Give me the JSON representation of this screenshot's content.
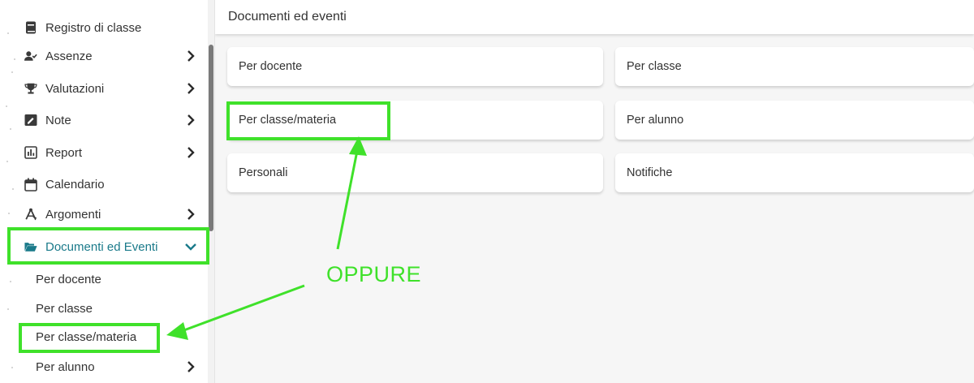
{
  "sidebar": {
    "items": [
      {
        "label": "Registro di classe",
        "icon": "book-icon"
      },
      {
        "label": "Assenze",
        "icon": "user-check-icon"
      },
      {
        "label": "Valutazioni",
        "icon": "trophy-icon"
      },
      {
        "label": "Note",
        "icon": "note-icon"
      },
      {
        "label": "Report",
        "icon": "report-chart-icon"
      },
      {
        "label": "Calendario",
        "icon": "calendar-icon"
      },
      {
        "label": "Argomenti",
        "icon": "compass-icon"
      },
      {
        "label": "Documenti ed Eventi",
        "icon": "folder-open-icon"
      }
    ],
    "subitems": [
      {
        "label": "Per docente"
      },
      {
        "label": "Per classe"
      },
      {
        "label": "Per classe/materia"
      },
      {
        "label": "Per alunno"
      }
    ]
  },
  "main": {
    "title": "Documenti ed eventi",
    "cards": [
      {
        "label": "Per docente"
      },
      {
        "label": "Per classe"
      },
      {
        "label": "Per classe/materia"
      },
      {
        "label": "Per alunno"
      },
      {
        "label": "Personali"
      },
      {
        "label": "Notifiche"
      }
    ]
  },
  "annotation": {
    "text": "OPPURE",
    "color": "#3fe12a"
  },
  "colors": {
    "accent": "#1a7a8a",
    "highlight": "#3fe12a"
  }
}
